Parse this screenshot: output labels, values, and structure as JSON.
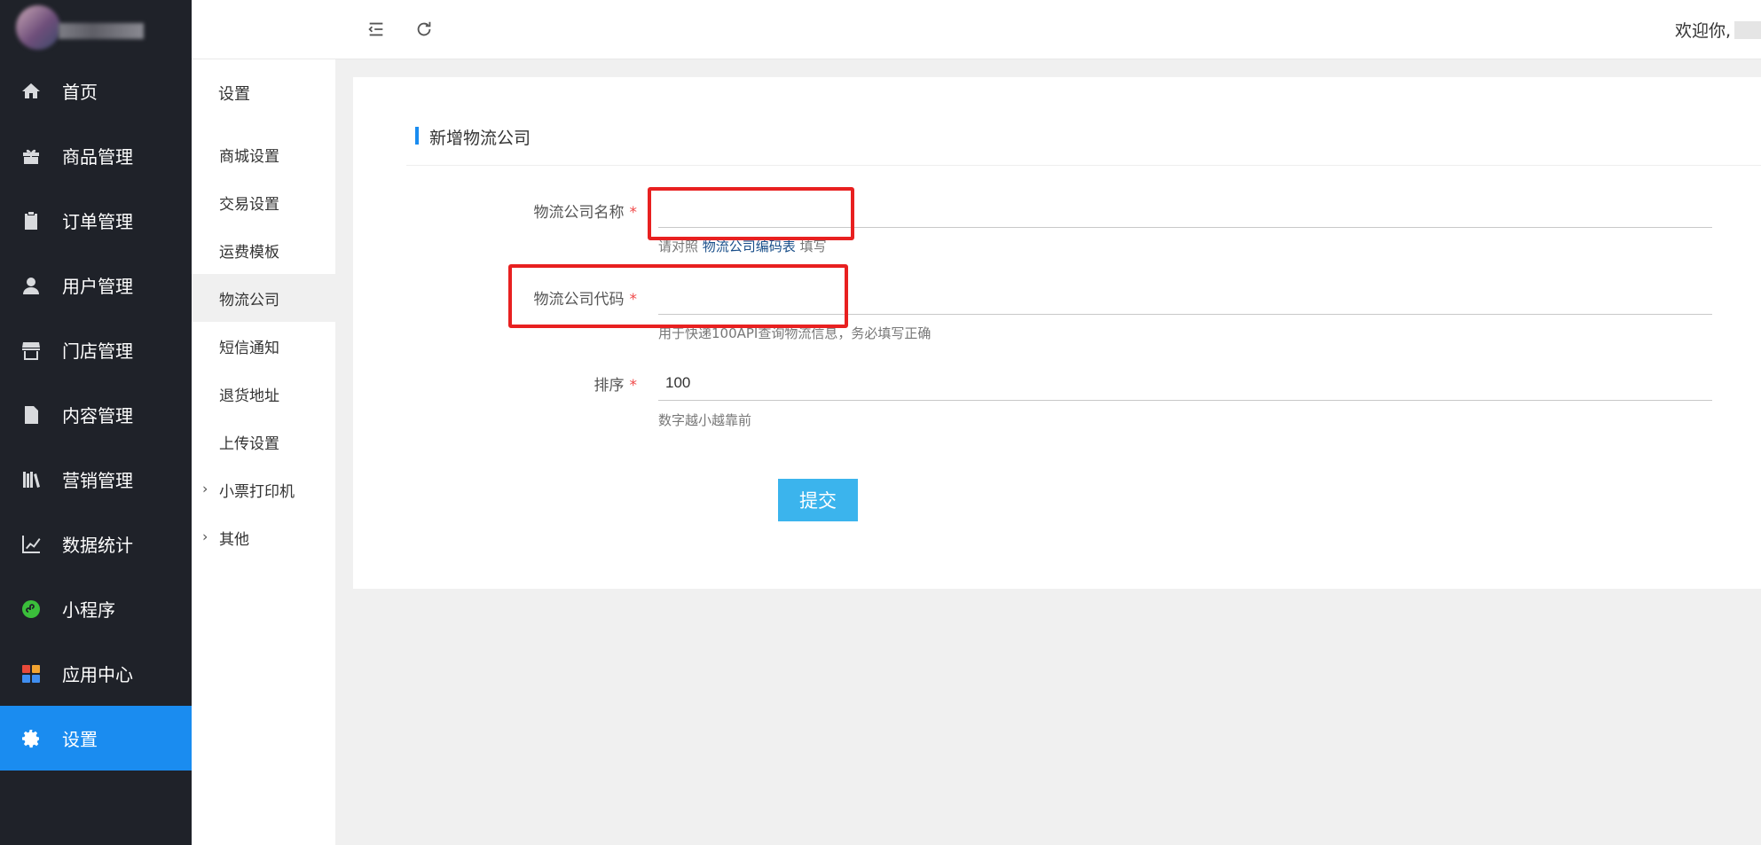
{
  "topbar": {
    "welcome": "欢迎你,"
  },
  "sidebar": {
    "items": [
      {
        "label": "首页",
        "icon": "home-icon"
      },
      {
        "label": "商品管理",
        "icon": "gift-icon"
      },
      {
        "label": "订单管理",
        "icon": "clipboard-icon"
      },
      {
        "label": "用户管理",
        "icon": "user-icon"
      },
      {
        "label": "门店管理",
        "icon": "store-icon"
      },
      {
        "label": "内容管理",
        "icon": "document-icon"
      },
      {
        "label": "营销管理",
        "icon": "books-icon"
      },
      {
        "label": "数据统计",
        "icon": "chart-icon"
      },
      {
        "label": "小程序",
        "icon": "miniprogram-icon"
      },
      {
        "label": "应用中心",
        "icon": "apps-icon"
      },
      {
        "label": "设置",
        "icon": "gear-icon",
        "active": true
      }
    ],
    "accent_color": "#1a8cf0"
  },
  "subnav": {
    "title": "设置",
    "items": [
      {
        "label": "商城设置"
      },
      {
        "label": "交易设置"
      },
      {
        "label": "运费模板"
      },
      {
        "label": "物流公司",
        "active": true
      },
      {
        "label": "短信通知"
      },
      {
        "label": "退货地址"
      },
      {
        "label": "上传设置"
      },
      {
        "label": "小票打印机",
        "expandable": true
      },
      {
        "label": "其他",
        "expandable": true
      }
    ]
  },
  "form": {
    "title": "新增物流公司",
    "fields": [
      {
        "label": "物流公司名称",
        "required_mark": "*",
        "value": "",
        "help_prefix": "请对照",
        "help_link": "物流公司编码表",
        "help_suffix": "填写"
      },
      {
        "label": "物流公司代码",
        "required_mark": "*",
        "value": "",
        "help": "用于快递100API查询物流信息，务必填写正确"
      },
      {
        "label": "排序",
        "required_mark": "*",
        "value": "100",
        "help": "数字越小越靠前"
      }
    ],
    "submit_label": "提交"
  }
}
